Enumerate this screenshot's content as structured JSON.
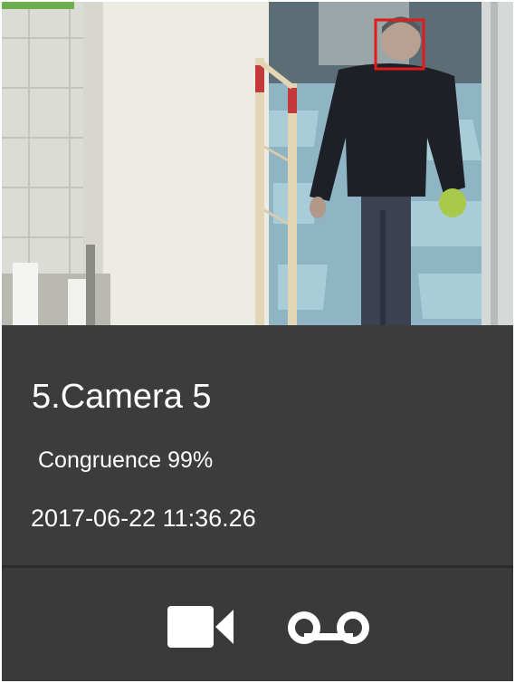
{
  "detection": {
    "camera_name": "5.Camera 5",
    "congruence": "Congruence 99%",
    "timestamp": "2017-06-22 11:36.26"
  },
  "colors": {
    "face_box": "#e11a1a",
    "panel_background": "#3c3c3c",
    "text": "#ffffff",
    "icon": "#ffffff"
  },
  "icons": {
    "video": "video-camera-icon",
    "voicemail": "voicemail-icon"
  }
}
